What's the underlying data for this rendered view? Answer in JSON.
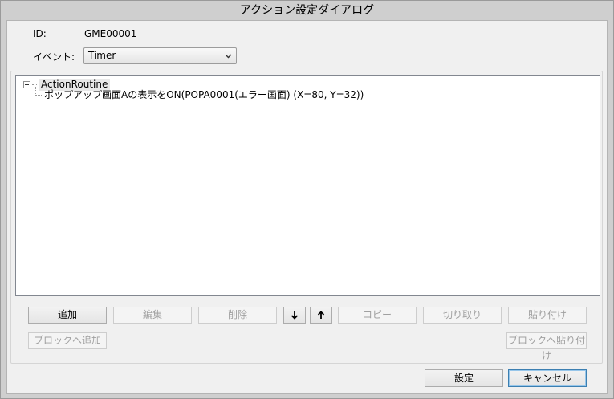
{
  "window": {
    "title": "アクション設定ダイアログ"
  },
  "form": {
    "id_label": "ID:",
    "id_value": "GME00001",
    "event_label": "イベント:",
    "event_value": "Timer"
  },
  "tree": {
    "root": "ActionRoutine",
    "children": [
      "ポップアップ画面Aの表示をON(POPA0001(エラー画面) (X=80, Y=32))"
    ]
  },
  "toolbar": {
    "add": "追加",
    "edit": "編集",
    "delete": "削除",
    "copy": "コピー",
    "cut": "切り取り",
    "paste": "貼り付け",
    "add_to_block": "ブロックへ追加",
    "paste_to_block": "ブロックへ貼り付け"
  },
  "footer": {
    "ok": "設定",
    "cancel": "キャンセル"
  }
}
